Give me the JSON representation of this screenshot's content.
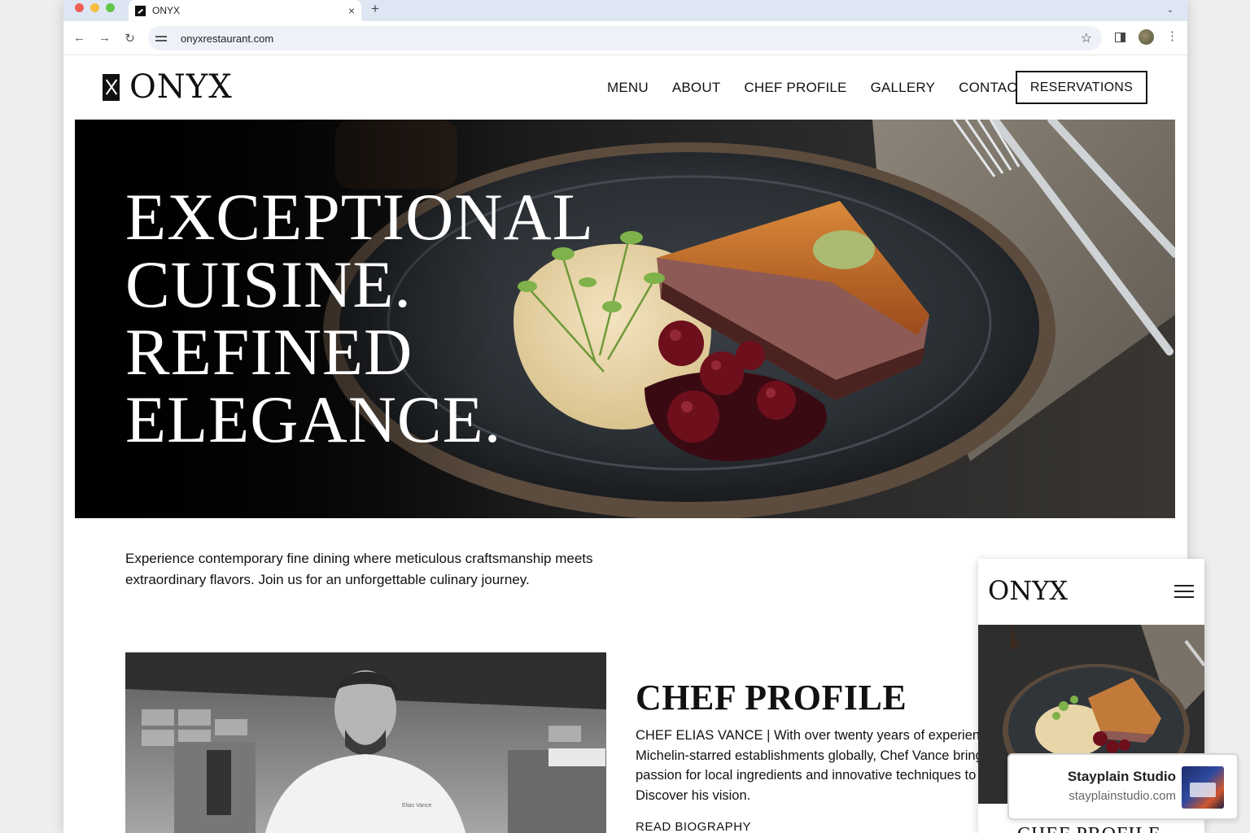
{
  "browser": {
    "tab_title": "ONYX",
    "tab_close": "×",
    "new_tab": "+",
    "tab_menu": "⌄",
    "back": "←",
    "forward": "→",
    "reload": "↻",
    "url": "onyxrestaurant.com",
    "bookmark_star": "☆",
    "menu_dots": "⋮"
  },
  "site": {
    "logo": "ONYX",
    "nav": [
      "MENU",
      "ABOUT",
      "CHEF PROFILE",
      "GALLERY",
      "CONTACT"
    ],
    "cta": "RESERVATIONS",
    "hero_lines": [
      "EXCEPTIONAL",
      "CUISINE.",
      "REFINED",
      "ELEGANCE."
    ],
    "intro_lines": [
      "Experience contemporary fine dining where meticulous craftsmanship meets",
      "extraordinary flavors. Join us for an unforgettable culinary journey."
    ],
    "chef": {
      "title": "CHEF PROFILE",
      "lines": [
        "CHEF ELIAS VANCE  |  With over twenty years of experienc",
        "Michelin-starred establishments globally, Chef Vance bring",
        "passion for local ingredients and innovative techniques to C",
        "Discover his vision."
      ],
      "read_more": "READ BIOGRAPHY",
      "jacket_name": "Elias Vance"
    }
  },
  "mobile": {
    "logo": "ONYX",
    "heading": "CHEF PROFILE"
  },
  "badge": {
    "name": "Stayplain Studio",
    "url": "stayplainstudio.com"
  },
  "colors": {
    "ink": "#111111",
    "tabbar": "#dfe6f3",
    "omnibox": "#eef1f8"
  },
  "icons": [
    "close-icon",
    "plus-icon",
    "chevron-down-icon",
    "back-icon",
    "forward-icon",
    "reload-icon",
    "site-settings-icon",
    "star-icon",
    "side-panel-icon",
    "profile-avatar",
    "more-icon",
    "hamburger-icon"
  ]
}
